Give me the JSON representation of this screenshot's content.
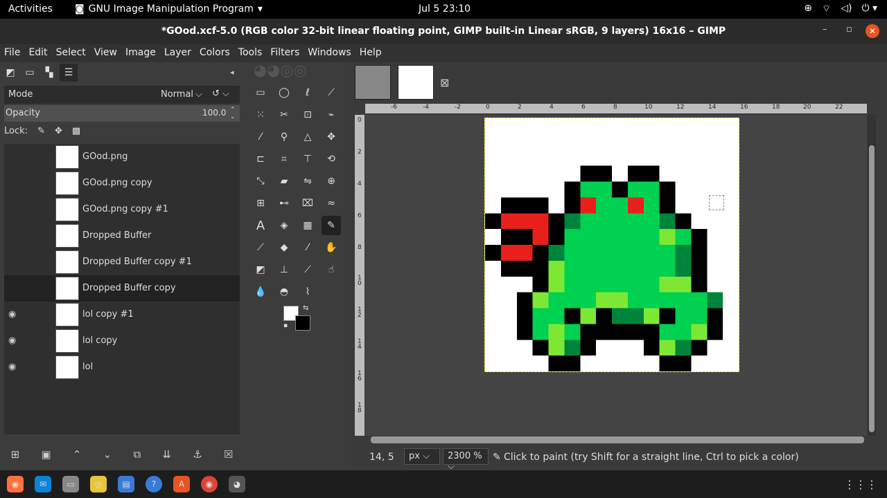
{
  "topbar": {
    "activities": "Activities",
    "app_name": "GNU Image Manipulation Program",
    "clock": "Jul 5  23:10"
  },
  "window": {
    "title": "*GOod.xcf-5.0 (RGB color 32-bit linear floating point, GIMP built-in Linear sRGB, 9 layers) 16x16 – GIMP"
  },
  "menu": [
    "File",
    "Edit",
    "Select",
    "View",
    "Image",
    "Layer",
    "Colors",
    "Tools",
    "Filters",
    "Windows",
    "Help"
  ],
  "layers_panel": {
    "mode_label": "Mode",
    "mode_value": "Normal",
    "opacity_label": "Opacity",
    "opacity_value": "100.0",
    "lock_label": "Lock:"
  },
  "layers": [
    {
      "name": "GOod.png",
      "visible": false
    },
    {
      "name": "GOod.png copy",
      "visible": false
    },
    {
      "name": "GOod.png copy #1",
      "visible": false
    },
    {
      "name": "Dropped Buffer",
      "visible": false
    },
    {
      "name": "Dropped Buffer copy #1",
      "visible": false
    },
    {
      "name": "Dropped Buffer copy",
      "visible": false,
      "selected": true
    },
    {
      "name": "lol copy #1",
      "visible": true
    },
    {
      "name": "lol copy",
      "visible": true
    },
    {
      "name": "lol",
      "visible": true
    }
  ],
  "ruler": {
    "h_ticks": [
      "-6",
      "-4",
      "-2",
      "0",
      "2",
      "4",
      "6",
      "8",
      "10",
      "12",
      "14",
      "16",
      "18",
      "20",
      "22"
    ],
    "v_ticks": [
      "0",
      "2",
      "4",
      "6",
      "8",
      "1\n0",
      "1\n2",
      "1\n4",
      "1\n6",
      "1\n8"
    ]
  },
  "status": {
    "coords": "14, 5",
    "unit": "px",
    "zoom": "2300 %",
    "message": "Click to paint (try Shift for a straight line, Ctrl to pick a color)"
  },
  "colors": {
    "accent": "#e95420",
    "green": "#00d150",
    "dark_green": "#00833a",
    "light_green": "#7de833",
    "red": "#e8201c",
    "black": "#000000"
  }
}
